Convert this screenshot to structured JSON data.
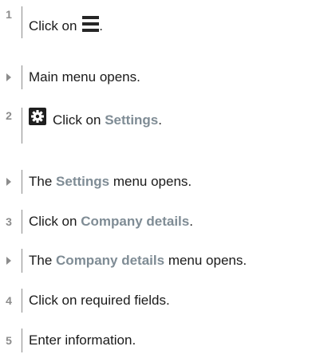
{
  "steps": [
    {
      "marker": "1",
      "text_before": "Click on",
      "text_after": "."
    },
    {
      "marker": "",
      "text": "Main menu opens."
    },
    {
      "marker": "2",
      "text_before": "Click on",
      "highlight": "Settings",
      "text_after": "."
    },
    {
      "marker": "",
      "text_before": "The",
      "highlight": "Settings",
      "text_after": "menu opens."
    },
    {
      "marker": "3",
      "text_before": "Click on",
      "highlight": "Company details",
      "text_after": "."
    },
    {
      "marker": "",
      "text_before": "The",
      "highlight": "Company details",
      "text_after": "menu opens."
    },
    {
      "marker": "4",
      "text": "Click on required fields."
    },
    {
      "marker": "5",
      "text": "Enter information."
    }
  ],
  "icons": {
    "menu": "hamburger-menu-icon",
    "settings": "gear-icon"
  },
  "colors": {
    "marker": "#8c8c8c",
    "highlight": "#7f8c95"
  }
}
